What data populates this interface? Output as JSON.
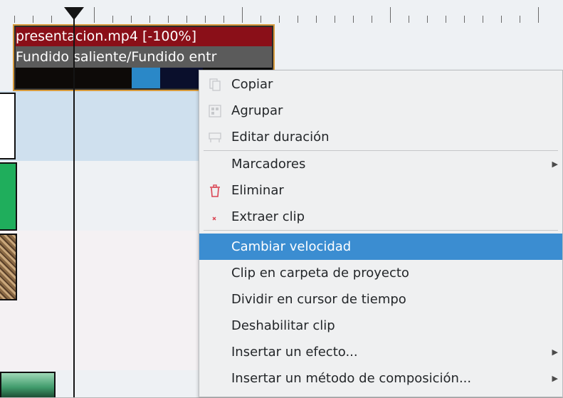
{
  "timeline": {
    "clip": {
      "title": "presentacion.mp4 [-100%]",
      "transition": "Fundido saliente/Fundido entr"
    }
  },
  "context_menu": {
    "items": [
      {
        "label": "Copiar",
        "icon": "copy-icon"
      },
      {
        "label": "Agrupar",
        "icon": "group-icon"
      },
      {
        "label": "Editar duración",
        "icon": "edit-duration-icon"
      },
      {
        "label": "Marcadores",
        "submenu": true
      },
      {
        "label": "Eliminar",
        "icon": "trash-icon"
      },
      {
        "label": "Extraer clip",
        "icon": "extract-clip-icon"
      },
      {
        "label": "Cambiar velocidad",
        "highlighted": true
      },
      {
        "label": "Clip en carpeta de proyecto"
      },
      {
        "label": "Dividir en cursor de tiempo"
      },
      {
        "label": "Deshabilitar clip"
      },
      {
        "label": "Insertar un efecto...",
        "submenu": true
      },
      {
        "label": "Insertar un método de composición...",
        "submenu": true
      }
    ]
  },
  "colors": {
    "highlight": "#3b8dd1",
    "clip_title_bg": "#8a0f18",
    "clip_border": "#d79a3c",
    "selected_track": "#cfe0ee"
  }
}
